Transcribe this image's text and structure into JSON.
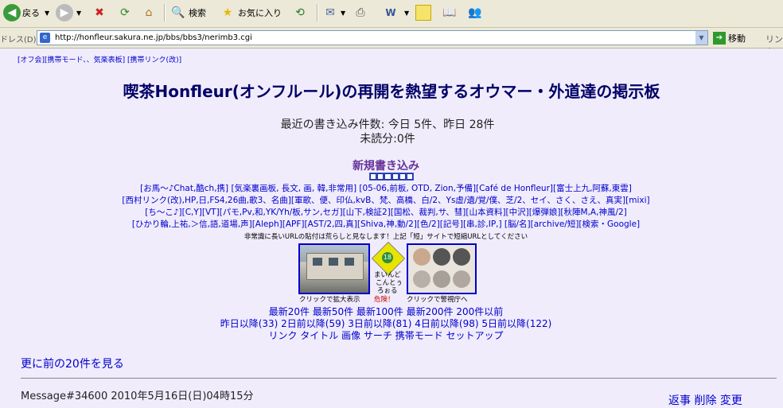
{
  "toolbar": {
    "back": "戻る",
    "search": "検索",
    "favorites": "お気に入り"
  },
  "address": {
    "label": "ドレス(D)",
    "url": "http://honfleur.sakura.ne.jp/bbs/bbs3/nerimb3.cgi",
    "go": "移動",
    "links": "リンク"
  },
  "page": {
    "top_links": "[オフ会][携帯モード、、気楽表板] [携帯リンク(改)]",
    "title": "喫茶Honfleur(オンフルール)の再開を熱望するオウマー・外道達の掲示板",
    "stats_line1": "最近の書き込み件数: 今日 5件、昨日 28件",
    "stats_line2": "未読分:0件",
    "new_post": "新規書き込み",
    "link_rows": [
      "[お馬〜♪Chat,酷ch,携] [気楽裏画板, 長文, 画, 韓,非常用] [05-06,前板, OTD, Zion,予備][Café de Honfleur][富士上九,阿蘇,東雲]",
      "[西村リンク(改),HP,日,FS4,26曲,歌3、名曲][軍歌、便、印仏,kvB、梵、高橋、白/2、Ys虚/遺/覚/僕、芝/2、セイ、さく、さえ、真実][mixi]",
      "[ち〜こ♪][C,Y][VT][パモ,Pv,和,YK/Yh/板,サン,セガ][山下,検証2][国松、裁判,サ、彗][山本資料][中沢][爆弾娘][秋陣M,A,神風/2]",
      "[ひかり輪,上祐,＞信,語,道場,声][Aleph][APF][AST/2,四,真][Shiva,神,動/2][色/2][記号][串,診,IP,] [脳/名][archive/短][検索・Google]"
    ],
    "warning": "非常識に長いURLの貼付は荒らしと見なします！上記「短」サイトで短縮URLとしてください",
    "caption_photo": "クリックで拡大表示",
    "caption_sign_1": "まいんど",
    "caption_sign_2": "こんとぅ",
    "caption_sign_3": "ろぉる",
    "caption_danger": "危険！",
    "sign_number": "18",
    "caption_police": "クリックで警視庁へ",
    "nav_row1": "最新20件 最新50件 最新100件 最新200件 200件以前",
    "nav_row2": "昨日以降(33) 2日前以降(59) 3日前以降(81) 4日前以降(98) 5日前以降(122)",
    "nav_row3": "リンク タイトル 画像 サーチ 携帯モード セットアップ",
    "older": "更に前の20件を見る",
    "message_line": "Message#34600 2010年5月16日(日)04時15分",
    "actions": "返事 削除 変更"
  }
}
